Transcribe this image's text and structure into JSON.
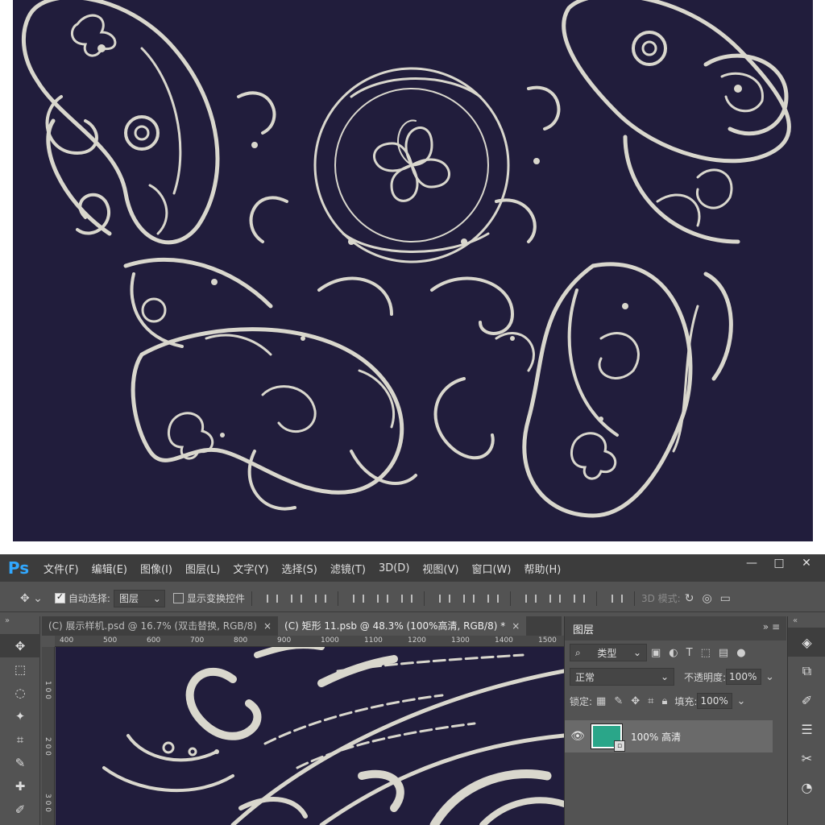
{
  "preview_colors": {
    "background": "#211d3c",
    "ornament": "#d9d7cd"
  },
  "app": {
    "logo": "Ps"
  },
  "menu": [
    "文件(F)",
    "编辑(E)",
    "图像(I)",
    "图层(L)",
    "文字(Y)",
    "选择(S)",
    "滤镜(T)",
    "3D(D)",
    "视图(V)",
    "窗口(W)",
    "帮助(H)"
  ],
  "window_controls": {
    "minimize": "—",
    "restore": "□",
    "close": "✕"
  },
  "options": {
    "auto_select_label": "自动选择:",
    "auto_select_checked": true,
    "auto_select_target": "图层",
    "show_transform_label": "显示变换控件",
    "show_transform_checked": false,
    "mode3d_label": "3D 模式:"
  },
  "tabs": [
    {
      "label": "(C) 展示样机.psd @ 16.7% (双击替换, RGB/8)",
      "close": "×",
      "active": false
    },
    {
      "label": "(C) 矩形 11.psb @ 48.3% (100%高清, RGB/8) *",
      "close": "×",
      "active": true
    }
  ],
  "ruler_h": [
    "400",
    "500",
    "600",
    "700",
    "800",
    "900",
    "1000",
    "1100",
    "1200",
    "1300",
    "1400",
    "1500"
  ],
  "ruler_v": [
    "1 0 0",
    "2 0 0",
    "3 0 0"
  ],
  "tools": [
    "move-tool",
    "marquee-tool",
    "lasso-tool",
    "magic-wand-tool",
    "crop-tool",
    "eyedropper-tool",
    "healing-tool",
    "brush-tool"
  ],
  "layers_panel": {
    "title": "图层",
    "filter_kind": "类型",
    "blend_mode": "正常",
    "opacity_label": "不透明度:",
    "opacity_value": "100%",
    "lock_label": "锁定:",
    "fill_label": "填充:",
    "fill_value": "100%",
    "layers": [
      {
        "name": "100% 高清",
        "visible": true,
        "thumb_color": "#2aa689"
      }
    ]
  },
  "dock_icons": [
    "layers-icon",
    "history-icon",
    "brush-settings-icon",
    "adjustments-icon",
    "tools-icon",
    "properties-icon"
  ]
}
